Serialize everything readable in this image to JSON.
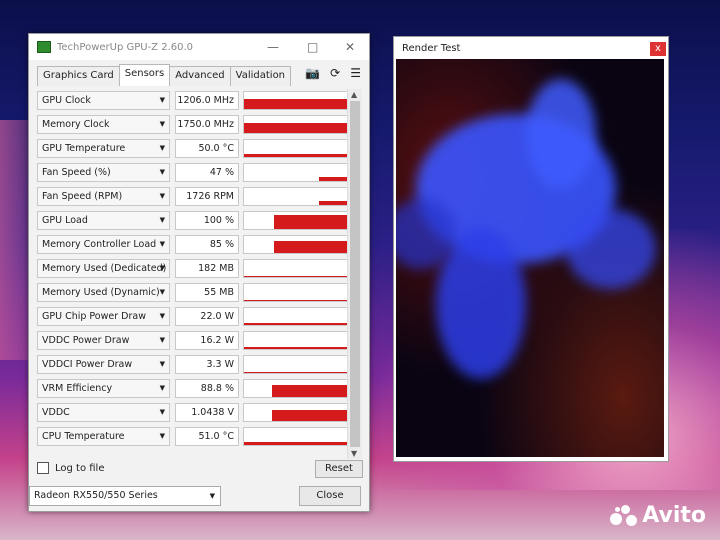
{
  "gpuz": {
    "title": "TechPowerUp GPU-Z 2.60.0",
    "tabs": [
      "Graphics Card",
      "Sensors",
      "Advanced",
      "Validation"
    ],
    "active_tab": "Sensors",
    "sensors": [
      {
        "label": "GPU Clock",
        "value": "1206.0 MHz",
        "level": 0.72
      },
      {
        "label": "Memory Clock",
        "value": "1750.0 MHz",
        "level": 0.75
      },
      {
        "label": "GPU Temperature",
        "value": "50.0 °C",
        "level": 0.3
      },
      {
        "label": "Fan Speed (%)",
        "value": "47 %",
        "level": 0.45
      },
      {
        "label": "Fan Speed (RPM)",
        "value": "1726 RPM",
        "level": 0.45
      },
      {
        "label": "GPU Load",
        "value": "100 %",
        "level": 1.0
      },
      {
        "label": "Memory Controller Load",
        "value": "85 %",
        "level": 0.85
      },
      {
        "label": "Memory Used (Dedicated)",
        "value": "182 MB",
        "level": 0.05
      },
      {
        "label": "Memory Used (Dynamic)",
        "value": "55 MB",
        "level": 0.05
      },
      {
        "label": "GPU Chip Power Draw",
        "value": "22.0 W",
        "level": 0.2
      },
      {
        "label": "VDDC Power Draw",
        "value": "16.2 W",
        "level": 0.2
      },
      {
        "label": "VDDCI Power Draw",
        "value": "3.3 W",
        "level": 0.1
      },
      {
        "label": "VRM Efficiency",
        "value": "88.8 %",
        "level": 0.85
      },
      {
        "label": "VDDC",
        "value": "1.0438 V",
        "level": 0.8
      },
      {
        "label": "CPU Temperature",
        "value": "51.0 °C",
        "level": 0.3
      }
    ],
    "log_to_file": "Log to file",
    "reset_button": "Reset",
    "gpu_selected": "Radeon RX550/550 Series",
    "close_button": "Close"
  },
  "render_test": {
    "title": "Render Test"
  },
  "watermark": "Avito",
  "colors": {
    "graph_red": "#d41a1a",
    "accent_blue": "#3a4dff"
  },
  "icons": [
    "camera-icon",
    "refresh-icon",
    "menu-icon",
    "close-icon",
    "minimize-icon",
    "maximize-icon"
  ]
}
